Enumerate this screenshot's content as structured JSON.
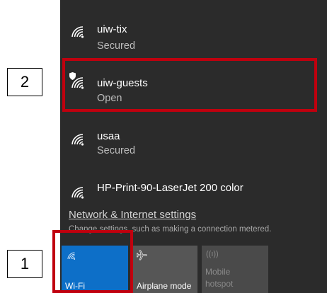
{
  "networks": [
    {
      "name": "uiw-tix",
      "status": "Secured",
      "icon": "wifi-icon"
    },
    {
      "name": "uiw-guests",
      "status": "Open",
      "icon": "wifi-icon",
      "badge": "shield-icon"
    },
    {
      "name": "usaa",
      "status": "Secured",
      "icon": "wifi-icon"
    },
    {
      "name": "HP-Print-90-LaserJet 200 color",
      "status": "",
      "icon": "wifi-icon"
    }
  ],
  "settings": {
    "link": "Network & Internet settings",
    "sub": "Change settings, such as making a connection metered."
  },
  "quick_actions": [
    {
      "label": "Wi-Fi",
      "icon": "wifi-icon",
      "state": "on",
      "color": "#0d6fc8"
    },
    {
      "label": "Airplane mode",
      "icon": "airplane-icon",
      "state": "off"
    },
    {
      "label_line1": "Mobile",
      "label_line2": "hotspot",
      "icon": "hotspot-icon",
      "state": "disabled"
    }
  ],
  "callouts": {
    "one": "1",
    "two": "2"
  },
  "highlight_color": "#c0000e"
}
